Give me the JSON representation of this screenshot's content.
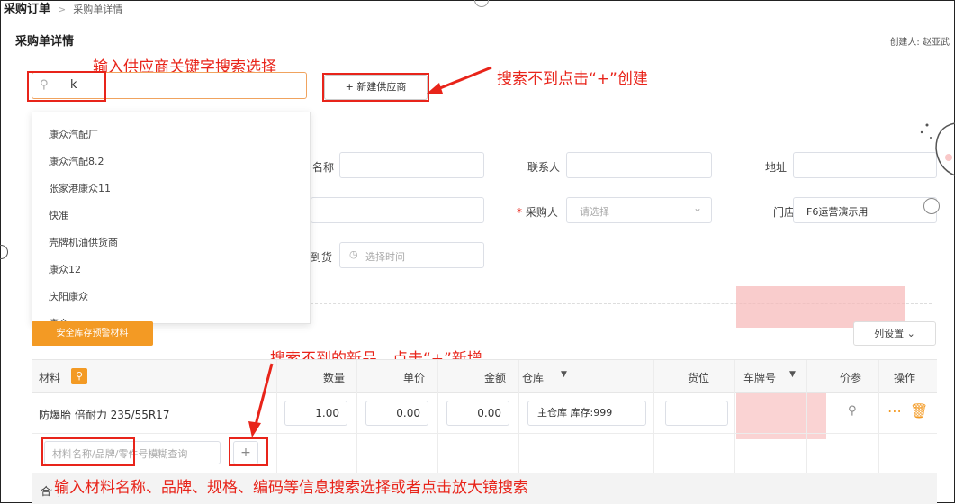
{
  "breadcrumb": {
    "current": "采购订单",
    "separator": ">",
    "sub": "采购单详情"
  },
  "page": {
    "title": "采购单详情",
    "creator": "创建人: 赵亚武"
  },
  "annotations": {
    "search_tip": "输入供应商关键字搜索选择",
    "create_tip": "搜索不到点击“+”创建",
    "new_item_tip": "搜索不到的新品，点击“+”新增",
    "material_tip": "输入材料名称、品牌、规格、编码等信息搜索选择或者点击放大镜搜索"
  },
  "supplier_search": {
    "value": "k"
  },
  "new_supplier_button": {
    "label": "+ 新建供应商"
  },
  "supplier_options": [
    "康众汽配厂",
    "康众汽配8.2",
    "张家港康众11",
    "快准",
    "壳牌机油供货商",
    "康众12",
    "庆阳康众",
    "康众"
  ],
  "form": {
    "name_label": "名称",
    "contact_label": "联系人",
    "address_label": "地址",
    "purchaser_label": "采购人",
    "purchaser_required": "*",
    "purchaser_placeholder": "请选择",
    "store_label": "门店",
    "store_value": "F6运营演示用",
    "arrival_label": "到货",
    "arrival_placeholder": "选择时间"
  },
  "safety_stock_button": {
    "label": "安全库存预警材料"
  },
  "column_settings": {
    "label": "列设置"
  },
  "table": {
    "headers": {
      "material": "材料",
      "qty": "数量",
      "price": "单价",
      "amount": "金额",
      "warehouse": "仓库",
      "location": "货位",
      "plate": "车牌号",
      "price_ref": "价参",
      "action": "操作"
    },
    "rows": [
      {
        "material": "防爆胎 倍耐力 235/55R17",
        "qty": "1.00",
        "price": "0.00",
        "amount": "0.00",
        "warehouse": "主仓库 库存:999"
      }
    ],
    "new_material_placeholder": "材料名称/品牌/零件号模糊查询",
    "footer_label": "合计"
  },
  "colors": {
    "accent": "#f39a24",
    "annotation": "#e8241a"
  }
}
